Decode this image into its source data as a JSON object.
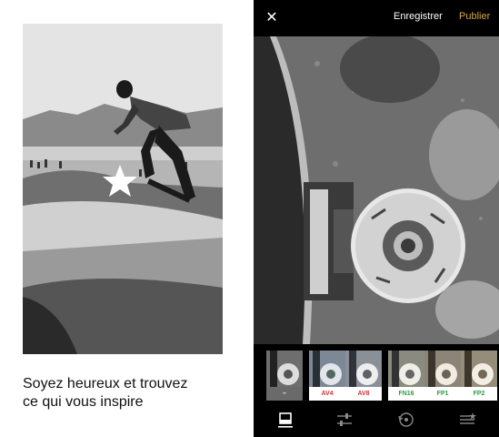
{
  "promo": {
    "caption_line1": "Soyez heureux et trouvez",
    "caption_line2": "ce qui vous inspire"
  },
  "editor": {
    "close_icon": "close-icon",
    "save_label": "Enregistrer",
    "publish_label": "Publier",
    "publish_color": "#d7a64a",
    "filters": [
      {
        "label": "–",
        "selected": true,
        "color": "#ffffff"
      },
      {
        "label": "AV4",
        "selected": false,
        "color": "#d0343a"
      },
      {
        "label": "AV8",
        "selected": false,
        "color": "#d0343a"
      },
      {
        "label": "FN16",
        "selected": false,
        "color": "#2e9b47"
      },
      {
        "label": "FP1",
        "selected": false,
        "color": "#2e9b47"
      },
      {
        "label": "FP2",
        "selected": false,
        "color": "#2e9b47"
      }
    ],
    "tools": [
      "crop-frame-icon",
      "adjust-sliders-icon",
      "history-icon",
      "recipes-icon"
    ]
  }
}
